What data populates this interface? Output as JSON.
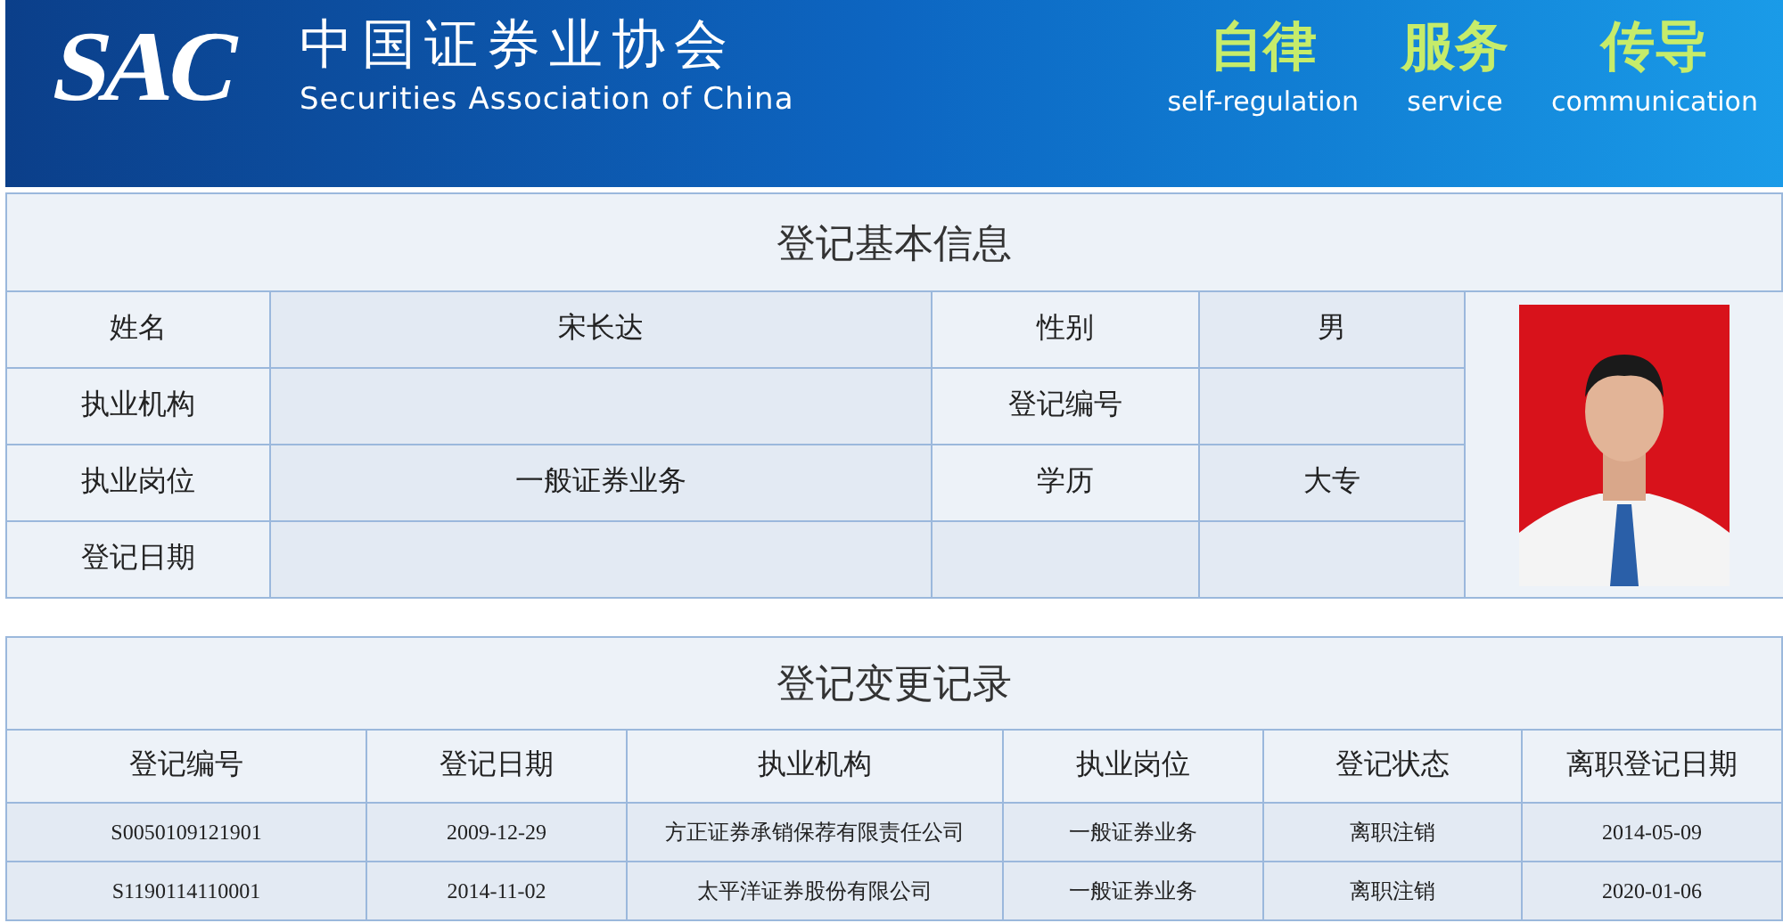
{
  "header": {
    "logo": "SAC",
    "title_cn": "中国证券业协会",
    "title_en": "Securities Association of China",
    "slogans": [
      {
        "cn": "自律",
        "en": "self-regulation"
      },
      {
        "cn": "服务",
        "en": "service"
      },
      {
        "cn": "传导",
        "en": "communication"
      }
    ]
  },
  "info": {
    "title": "登记基本信息",
    "rows": [
      {
        "cells": [
          {
            "kind": "label",
            "text": "姓名"
          },
          {
            "kind": "value",
            "text": "宋长达"
          },
          {
            "kind": "label",
            "text": "性别"
          },
          {
            "kind": "value",
            "text": "男"
          }
        ]
      },
      {
        "cells": [
          {
            "kind": "label",
            "text": "执业机构"
          },
          {
            "kind": "value"
          },
          {
            "kind": "label",
            "text": "登记编号"
          },
          {
            "kind": "value"
          }
        ]
      },
      {
        "cells": [
          {
            "kind": "label",
            "text": "执业岗位"
          },
          {
            "kind": "value",
            "text": "一般证券业务"
          },
          {
            "kind": "label",
            "text": "学历"
          },
          {
            "kind": "value",
            "text": "大专"
          }
        ]
      },
      {
        "cells": [
          {
            "kind": "label",
            "text": "登记日期"
          },
          {
            "kind": "value"
          },
          {
            "kind": "value"
          },
          {
            "kind": "value"
          }
        ]
      }
    ]
  },
  "changes": {
    "title": "登记变更记录",
    "columns": [
      "登记编号",
      "登记日期",
      "执业机构",
      "执业岗位",
      "登记状态",
      "离职登记日期"
    ],
    "rows": [
      [
        "S0050109121901",
        "2009-12-29",
        "方正证券承销保荐有限责任公司",
        "一般证券业务",
        "离职注销",
        "2014-05-09"
      ],
      [
        "S1190114110001",
        "2014-11-02",
        "太平洋证券股份有限公司",
        "一般证券业务",
        "离职注销",
        "2020-01-06"
      ]
    ]
  }
}
